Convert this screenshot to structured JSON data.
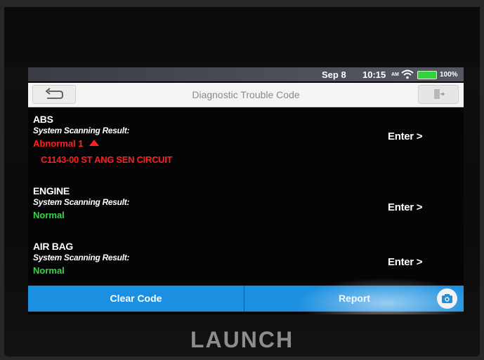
{
  "status_bar": {
    "date": "Sep 8",
    "time": "10:15",
    "ampm": "AM",
    "battery_percent": "100%",
    "battery_color": "#2fd33a"
  },
  "header": {
    "title": "Diagnostic Trouble Code",
    "back_icon": "back-arrow-icon",
    "exit_icon": "exit-door-icon"
  },
  "systems": [
    {
      "name": "ABS",
      "result_label": "System Scanning Result:",
      "status": "Abnormal 1",
      "status_color": "#ff2020",
      "dtc": "C1143-00 ST ANG SEN CIRCUIT",
      "enter_label": "Enter >"
    },
    {
      "name": "ENGINE",
      "result_label": "System Scanning Result:",
      "status": "Normal",
      "status_color": "#39d34a",
      "enter_label": "Enter >"
    },
    {
      "name": "AIR BAG",
      "result_label": "System Scanning Result:",
      "status": "Normal",
      "status_color": "#39d34a",
      "enter_label": "Enter >"
    }
  ],
  "footer": {
    "clear_code_label": "Clear Code",
    "report_label": "Report",
    "camera_icon": "camera-icon",
    "accent": "#1b8fe0"
  },
  "device": {
    "brand": "LAUNCH"
  }
}
